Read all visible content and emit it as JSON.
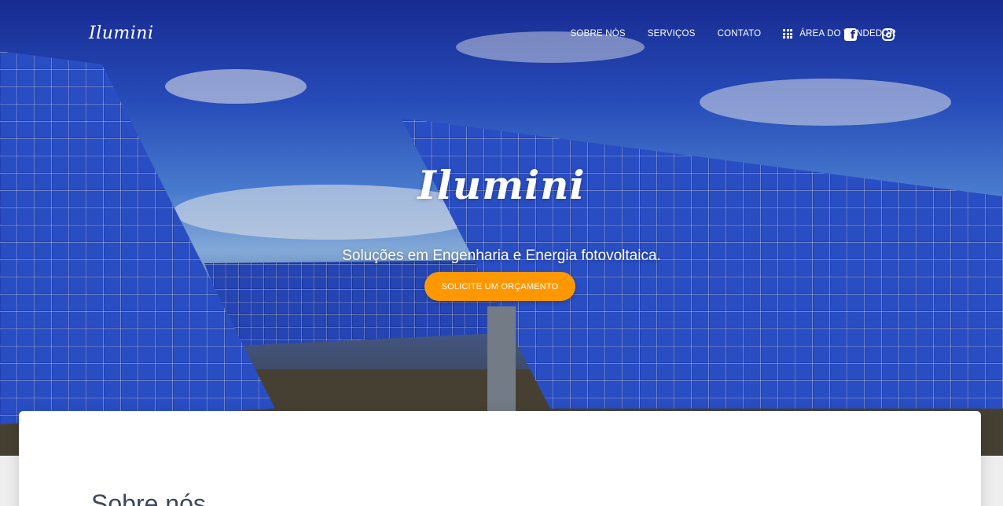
{
  "brand": {
    "logo_text": "Ilumini"
  },
  "nav": {
    "items": [
      {
        "label": "SOBRE NÓS"
      },
      {
        "label": "SERVIÇOS"
      },
      {
        "label": "CONTATO"
      },
      {
        "label": "ÁREA DO VENDEDOR",
        "icon": "apps-grid-icon"
      }
    ],
    "social": [
      {
        "icon": "facebook-icon"
      },
      {
        "icon": "instagram-icon"
      }
    ]
  },
  "hero": {
    "title": "Ilumini",
    "subtitle": "Soluções em Engenharia e Energia fotovoltaica.",
    "cta_label": "SOLICITE UM ORÇAMENTO"
  },
  "about": {
    "title": "Sobre nós"
  },
  "colors": {
    "accent": "#ff9800",
    "text_dark": "#3c4858",
    "panel_blue": "#1f3fb0"
  }
}
